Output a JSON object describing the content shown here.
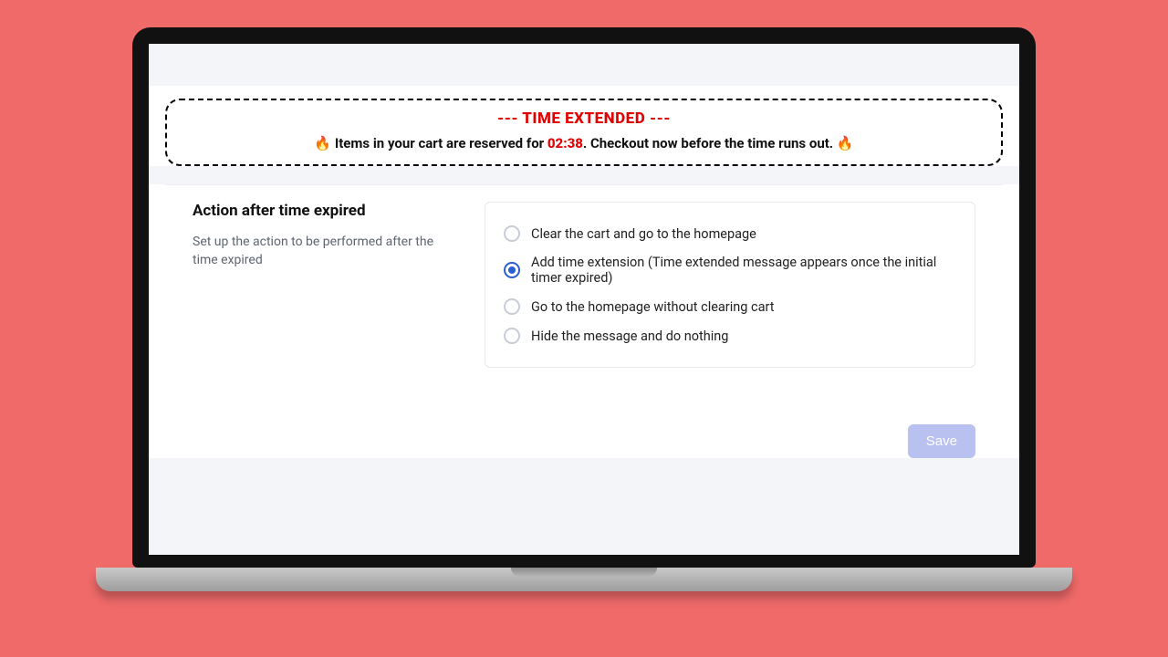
{
  "banner": {
    "title": "--- TIME EXTENDED ---",
    "prefix": "Items in your cart are reserved for ",
    "time": "02:38",
    "suffix": ". Checkout now before the time runs out.",
    "fire_icon": "🔥"
  },
  "settings": {
    "heading": "Action after time expired",
    "description": "Set up the action to be performed after the time expired",
    "options": [
      {
        "label": "Clear the cart and go to the homepage",
        "selected": false
      },
      {
        "label": "Add time extension (Time extended message appears once the initial timer expired)",
        "selected": true
      },
      {
        "label": "Go to the homepage without clearing cart",
        "selected": false
      },
      {
        "label": "Hide the message and do nothing",
        "selected": false
      }
    ]
  },
  "actions": {
    "save_label": "Save"
  }
}
